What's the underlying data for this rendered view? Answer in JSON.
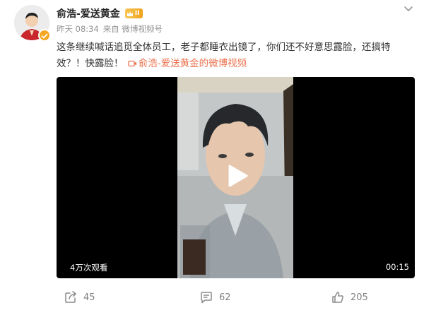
{
  "post": {
    "author": {
      "name": "俞浩-爱送黄金",
      "vip_level": "II",
      "verified": true
    },
    "meta": {
      "time": "昨天 08:34",
      "source": "来自 微博视频号"
    },
    "text": "这条继续喊话追觅全体员工，老子都睡衣出镜了，你们还不好意思露脸，还搞特效？！快露脸！",
    "video_link_text": "俞浩-爱送黄金的微博视频",
    "video": {
      "views": "4万次观看",
      "duration": "00:15"
    },
    "actions": {
      "repost_count": "45",
      "comment_count": "62",
      "like_count": "205"
    }
  },
  "colors": {
    "link": "#eb7350",
    "badge_gold": "#f0a21b",
    "meta_gray": "#939393"
  },
  "icons": [
    "more-icon",
    "video-camera-icon",
    "play-icon",
    "repost-icon",
    "comment-icon",
    "like-icon",
    "crown-icon",
    "verified-badge-icon"
  ]
}
